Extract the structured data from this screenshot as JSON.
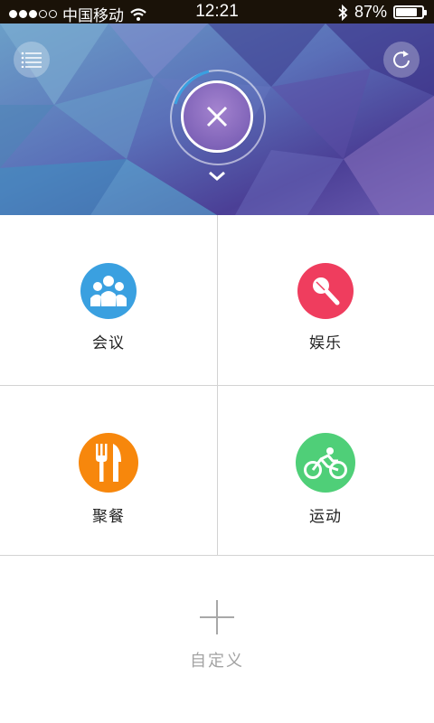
{
  "status_bar": {
    "carrier": "中国移动",
    "time": "12:21",
    "battery_percent_label": "87%",
    "battery_level": 0.87
  },
  "header": {
    "menu_icon": "list-icon",
    "refresh_icon": "refresh-icon",
    "close_icon": "close-icon",
    "expand_icon": "chevron-down-icon"
  },
  "categories": [
    {
      "label": "会议",
      "icon": "group-icon",
      "color": "#3aa0e0"
    },
    {
      "label": "娱乐",
      "icon": "microphone-icon",
      "color": "#ef3d5e"
    },
    {
      "label": "聚餐",
      "icon": "fork-knife-icon",
      "color": "#f7870c"
    },
    {
      "label": "运动",
      "icon": "bicycle-icon",
      "color": "#4fcf78"
    }
  ],
  "custom": {
    "label": "自定义",
    "icon": "plus-icon"
  }
}
